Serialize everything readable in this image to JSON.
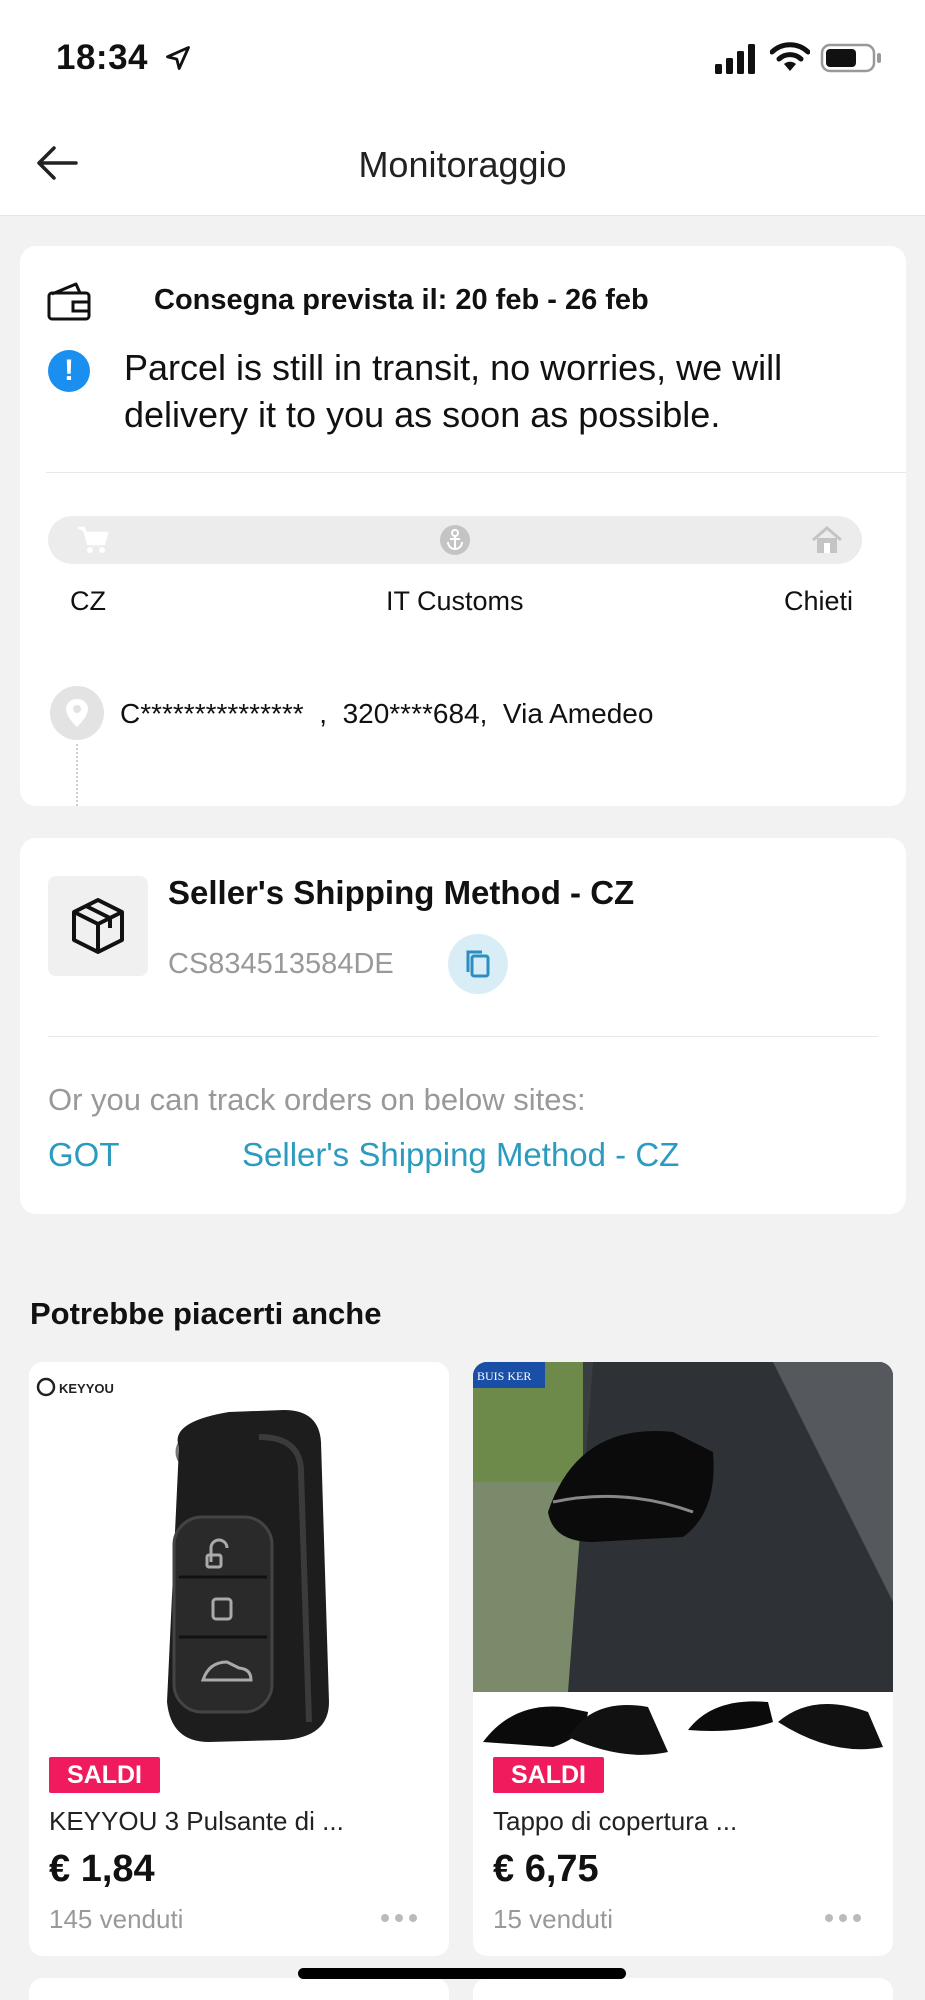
{
  "status_bar": {
    "time": "18:34"
  },
  "nav": {
    "title": "Monitoraggio"
  },
  "delivery": {
    "eta": "Consegna prevista il: 20 feb - 26 feb",
    "message": "Parcel is still in transit, no worries, we will delivery it to you as soon as possible.",
    "stops": [
      "CZ",
      "IT Customs",
      "Chieti"
    ],
    "address": "C***************  ,  320****684,  Via Amedeo"
  },
  "shipping": {
    "method": "Seller's Shipping Method - CZ",
    "tracking_number": "CS834513584DE",
    "other_sites_label": "Or you can track orders on below sites:",
    "sites": [
      "GOT",
      "Seller's Shipping Method - CZ"
    ]
  },
  "recommendations": {
    "title": "Potrebbe piacerti anche",
    "products": [
      {
        "badge": "SALDI",
        "brand": "KEYYOU",
        "name": "KEYYOU 3 Pulsante di ...",
        "price": "€ 1,84",
        "sold": "145 venduti"
      },
      {
        "badge": "SALDI",
        "brand": "BUIS KER",
        "name": "Tappo di copertura ...",
        "price": "€ 6,75",
        "sold": "15 venduti"
      }
    ]
  },
  "colors": {
    "accent_link": "#2b9bbf",
    "info_blue": "#1a8ff0",
    "sale_badge": "#ef1b5c"
  },
  "icons": [
    "location-arrow-icon",
    "signal-icon",
    "wifi-icon",
    "battery-icon",
    "back-arrow-icon",
    "wallet-icon",
    "info-icon",
    "cart-icon",
    "anchor-icon",
    "home-icon",
    "location-pin-icon",
    "package-icon",
    "copy-icon",
    "more-dots-icon"
  ]
}
